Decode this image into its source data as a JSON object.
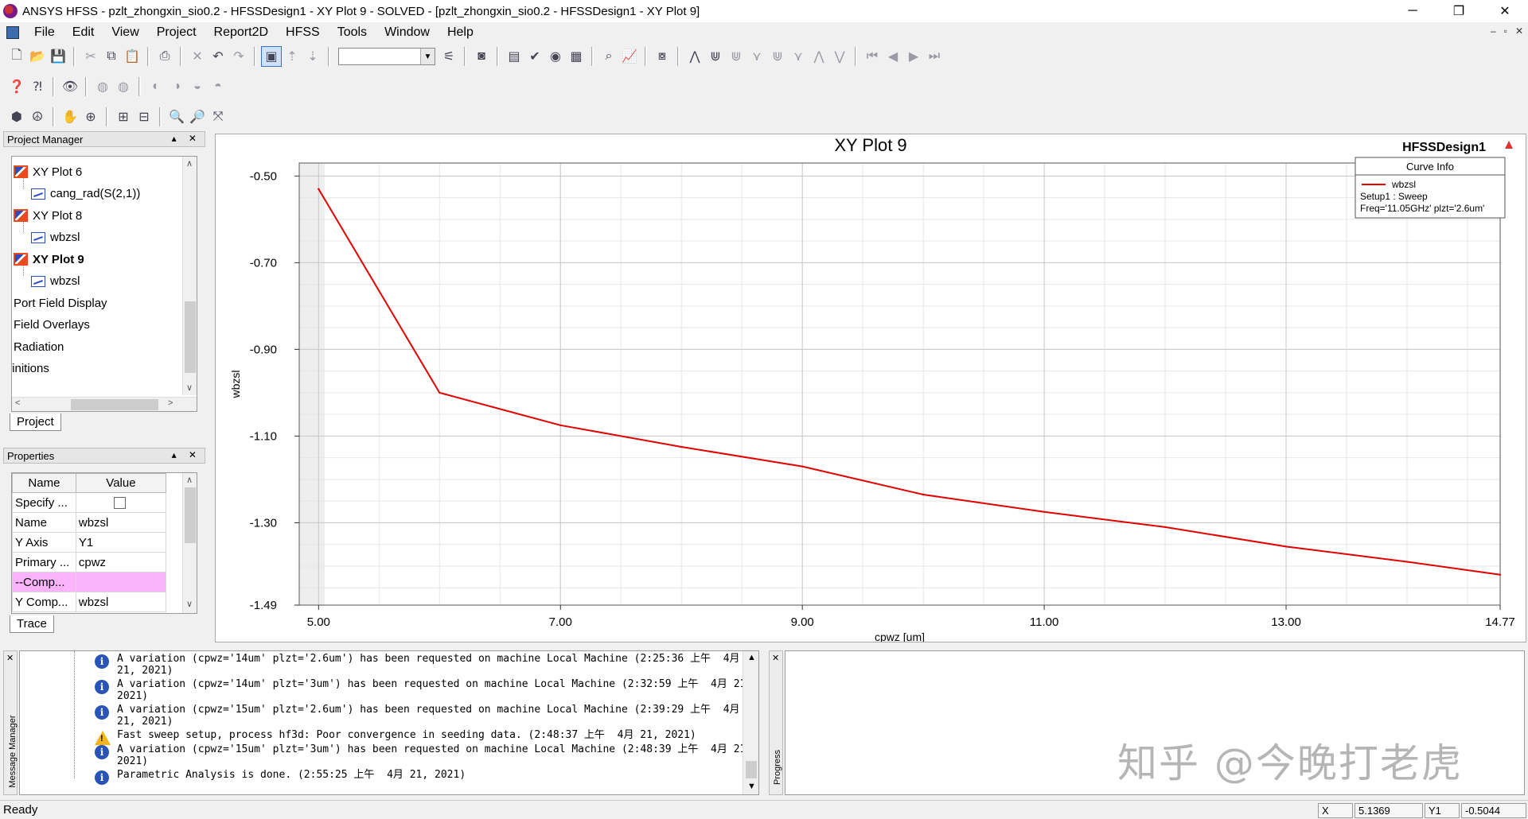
{
  "window": {
    "title": "ANSYS HFSS - pzlt_zhongxin_sio0.2 - HFSSDesign1 - XY Plot 9 - SOLVED - [pzlt_zhongxin_sio0.2 - HFSSDesign1 - XY Plot 9]",
    "minimize": "─",
    "restore": "❐",
    "close": "✕"
  },
  "menu": {
    "items": [
      "File",
      "Edit",
      "View",
      "Project",
      "Report2D",
      "HFSS",
      "Tools",
      "Window",
      "Help"
    ],
    "mdi_min": "–",
    "mdi_restore": "▫",
    "mdi_close": "✕"
  },
  "project_manager": {
    "header": "Project Manager",
    "header_buttons": "▴ ✕",
    "tree": [
      {
        "label": "XY Plot 6",
        "icon": "plot-icon",
        "level": 0,
        "bold": false
      },
      {
        "label": "cang_rad(S(2,1))",
        "icon": "trace-icon",
        "level": 1,
        "bold": false
      },
      {
        "label": "XY Plot 8",
        "icon": "plot-icon",
        "level": 0,
        "bold": false
      },
      {
        "label": "wbzsl",
        "icon": "trace-icon",
        "level": 1,
        "bold": false
      },
      {
        "label": "XY Plot 9",
        "icon": "plot-icon",
        "level": 0,
        "bold": true
      },
      {
        "label": "wbzsl",
        "icon": "trace-icon",
        "level": 1,
        "bold": false
      },
      {
        "label": "Port Field Display",
        "icon": "",
        "level": -1,
        "bold": false
      },
      {
        "label": "Field Overlays",
        "icon": "",
        "level": -1,
        "bold": false
      },
      {
        "label": "Radiation",
        "icon": "",
        "level": -1,
        "bold": false
      },
      {
        "label": "finitions",
        "icon": "",
        "level": -2,
        "bold": false
      }
    ],
    "tab": "Project"
  },
  "properties": {
    "header": "Properties",
    "header_buttons": "▴ ✕",
    "columns": [
      "Name",
      "Value"
    ],
    "rows": [
      {
        "name": "Specify ...",
        "value": "",
        "checkbox": true,
        "highlight": false
      },
      {
        "name": "Name",
        "value": "wbzsl",
        "checkbox": false,
        "highlight": false
      },
      {
        "name": "Y Axis",
        "value": "Y1",
        "checkbox": false,
        "highlight": false
      },
      {
        "name": "Primary ...",
        "value": "cpwz",
        "checkbox": false,
        "highlight": false
      },
      {
        "name": "--Comp...",
        "value": "",
        "checkbox": false,
        "highlight": true
      },
      {
        "name": "Y Comp...",
        "value": "wbzsl",
        "checkbox": false,
        "highlight": false
      }
    ],
    "tab": "Trace"
  },
  "plot": {
    "title": "XY Plot 9",
    "design": "HFSSDesign1",
    "curve_info": {
      "header": "Curve Info",
      "trace_name": "wbzsl",
      "line2": "Setup1 : Sweep",
      "line3": "Freq='11.05GHz' plzt='2.6um'"
    }
  },
  "chart_data": {
    "type": "line",
    "title": "XY Plot 9",
    "xlabel": "cpwz [um]",
    "ylabel": "wbzsl",
    "xlim": [
      4.84,
      14.77
    ],
    "ylim": [
      -1.49,
      -0.47
    ],
    "x_ticks": [
      5.0,
      7.0,
      9.0,
      11.0,
      13.0,
      14.77
    ],
    "x_tick_labels": [
      "5.00",
      "7.00",
      "9.00",
      "11.00",
      "13.00",
      "14.77"
    ],
    "y_ticks": [
      -0.5,
      -0.7,
      -0.9,
      -1.1,
      -1.3,
      -1.49
    ],
    "y_tick_labels": [
      "-0.50",
      "-0.70",
      "-0.90",
      "-1.10",
      "-1.30",
      "-1.49"
    ],
    "grid": true,
    "legend_position": "top-right",
    "color": "#e00000",
    "series": [
      {
        "name": "wbzsl",
        "x": [
          5.0,
          6.0,
          7.0,
          8.0,
          9.0,
          10.0,
          11.0,
          12.0,
          13.0,
          14.0,
          14.77
        ],
        "y": [
          -0.53,
          -1.0,
          -1.075,
          -1.125,
          -1.17,
          -1.235,
          -1.275,
          -1.31,
          -1.355,
          -1.39,
          -1.42
        ]
      }
    ]
  },
  "messages": {
    "side_label": "Message Manager",
    "items": [
      {
        "type": "info",
        "text": "A variation (cpwz='14um' plzt='2.6um') has been requested on machine Local Machine (2:25:36 上午  4月\n21, 2021)"
      },
      {
        "type": "info",
        "text": "A variation (cpwz='14um' plzt='3um') has been requested on machine Local Machine (2:32:59 上午  4月 21,\n2021)"
      },
      {
        "type": "info",
        "text": "A variation (cpwz='15um' plzt='2.6um') has been requested on machine Local Machine (2:39:29 上午  4月\n21, 2021)"
      },
      {
        "type": "warning",
        "text": "Fast sweep setup, process hf3d: Poor convergence in seeding data. (2:48:37 上午  4月 21, 2021)"
      },
      {
        "type": "info",
        "text": "A variation (cpwz='15um' plzt='3um') has been requested on machine Local Machine (2:48:39 上午  4月 21,\n2021)"
      },
      {
        "type": "info",
        "text": "Parametric Analysis is done. (2:55:25 上午  4月 21, 2021)"
      }
    ]
  },
  "progress": {
    "side_label": "Progress"
  },
  "watermark": "知乎 @今晚打老虎",
  "status": {
    "ready": "Ready",
    "x_label": "X",
    "x_value": "5.1369",
    "y_label": "Y1",
    "y_value": "-0.5044"
  }
}
